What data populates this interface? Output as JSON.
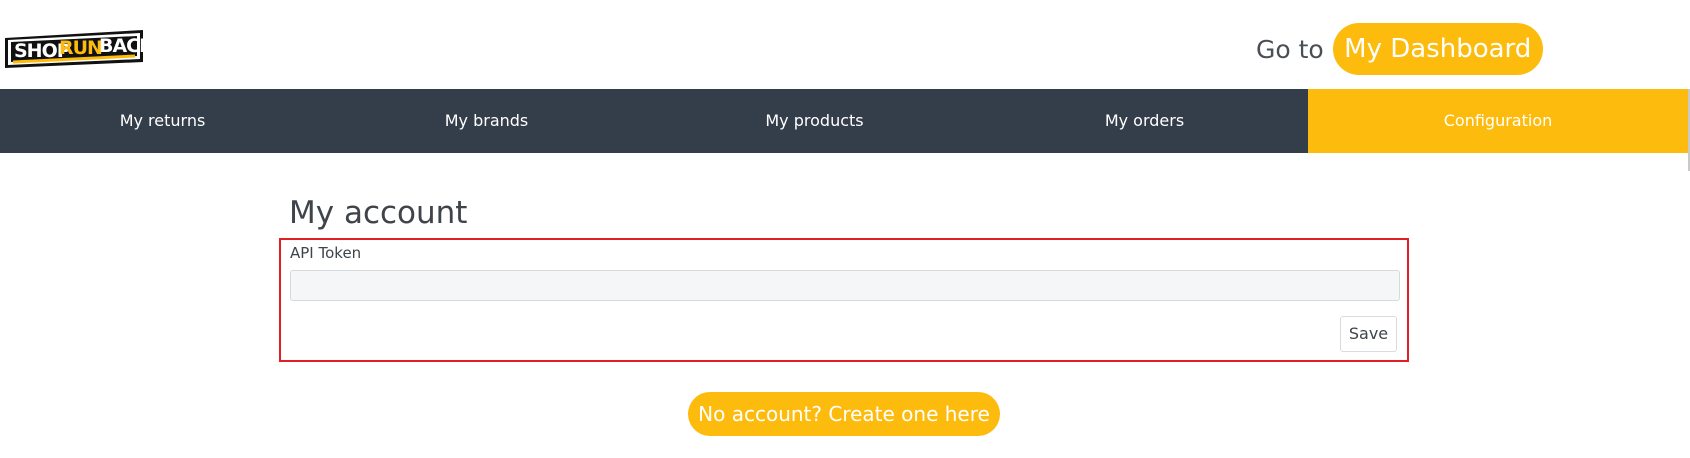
{
  "header": {
    "logo_text": "SHOPRUNBACK",
    "goto_label": "Go to",
    "dashboard_button": "My Dashboard"
  },
  "nav": {
    "items": [
      {
        "label": "My returns"
      },
      {
        "label": "My brands"
      },
      {
        "label": "My products"
      },
      {
        "label": "My orders"
      },
      {
        "label": "Configuration",
        "active": true
      }
    ]
  },
  "main": {
    "title": "My account",
    "api_token_label": "API Token",
    "api_token_value": "",
    "save_label": "Save",
    "create_account_label": "No account? Create one here"
  },
  "colors": {
    "accent": "#fdbb0d",
    "nav_bg": "#343d4a",
    "highlight_border": "#e01e25"
  }
}
